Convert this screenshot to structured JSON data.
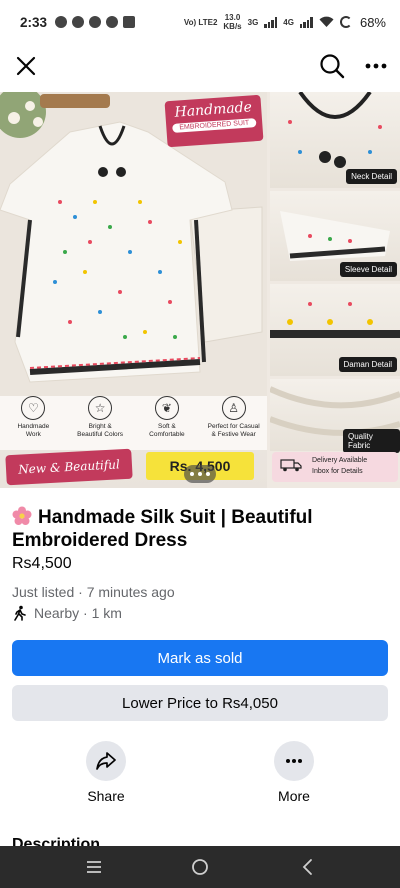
{
  "status_bar": {
    "time": "2:33",
    "network_top": "Vo) LTE2",
    "speed_value": "13.0",
    "speed_unit": "KB/s",
    "net_3g": "3G",
    "net_4g": "4G",
    "battery": "68%"
  },
  "top_bar": {
    "close_icon": "close-icon",
    "search_icon": "search-icon",
    "more_icon": "more-icon"
  },
  "photo": {
    "badge_title": "Handmade",
    "badge_subtitle": "EMBROIDERED SUIT",
    "thumbs": [
      {
        "label": "Neck Detail"
      },
      {
        "label": "Sleeve Detail"
      },
      {
        "label": "Daman Detail"
      },
      {
        "label": "Quality Fabric"
      }
    ],
    "features": [
      {
        "icon": "heart-icon",
        "line1": "Handmade",
        "line2": "Work"
      },
      {
        "icon": "star-icon",
        "line1": "Bright &",
        "line2": "Beautiful Colors"
      },
      {
        "icon": "leaf-icon",
        "line1": "Soft &",
        "line2": "Comfortable"
      },
      {
        "icon": "dress-icon",
        "line1": "Perfect for Casual",
        "line2": "& Festive Wear"
      }
    ],
    "banner_new": "New & Beautiful",
    "banner_price": "Rs. 4,500",
    "delivery_line1": "Delivery Available",
    "delivery_line2": "Inbox for Details"
  },
  "listing": {
    "title": "Handmade Silk Suit | Beautiful Embroidered Dress",
    "price": "Rs4,500",
    "listed": "Just listed · 7 minutes ago",
    "location": "Nearby · 1 km"
  },
  "buttons": {
    "mark_sold": "Mark as sold",
    "lower_price": "Lower Price to Rs4,050"
  },
  "actions": [
    {
      "label": "Share",
      "icon": "share-icon"
    },
    {
      "label": "More",
      "icon": "more-icon"
    }
  ],
  "description_heading": "Description",
  "colors": {
    "primary": "#1877f2",
    "secondary_bg": "#e4e6eb",
    "muted_text": "#65676b",
    "badge_pink": "#c23a5c",
    "price_yellow": "#f6e23a",
    "nav_bar": "#2b2b2b"
  }
}
